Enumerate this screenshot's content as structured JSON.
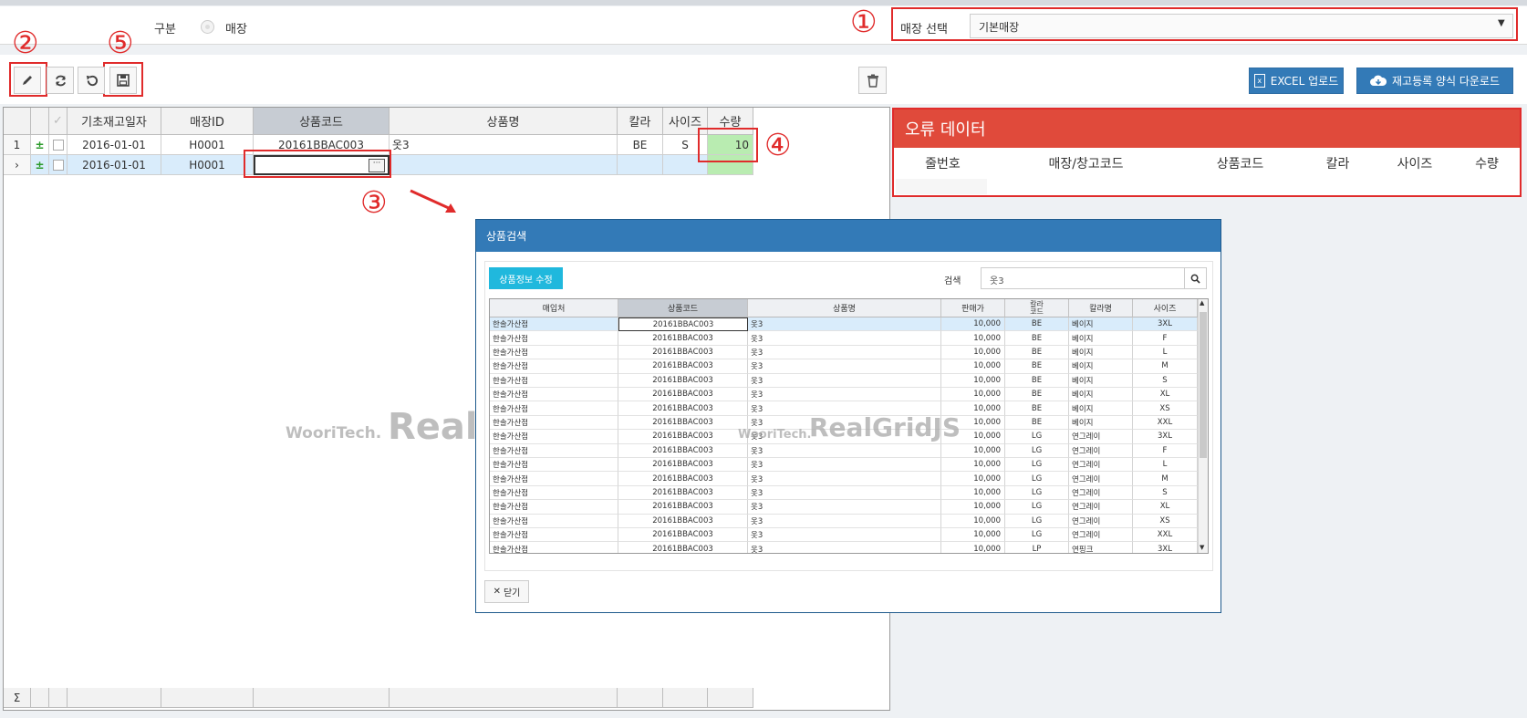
{
  "filter": {
    "label": "구분",
    "radio_label": "매장",
    "store_select_label": "매장 선택",
    "store_select_value": "기본매장"
  },
  "annotations": {
    "n1": "①",
    "n2": "②",
    "n3": "③",
    "n4": "④",
    "n5": "⑤"
  },
  "toolbar": {
    "icons": [
      "pencil-icon",
      "refresh-icon",
      "undo-icon",
      "save-icon",
      "trash-icon"
    ],
    "excel_upload": "EXCEL 업로드",
    "template_download": "재고등록 양식 다운로드"
  },
  "grid": {
    "columns": [
      "기초재고일자",
      "매장ID",
      "상품코드",
      "상품명",
      "칼라",
      "사이즈",
      "수량"
    ],
    "rows": [
      {
        "num": "1",
        "date": "2016-01-01",
        "store": "H0001",
        "code": "20161BBAC003",
        "name": "옷3",
        "color": "BE",
        "size": "S",
        "qty": "10"
      },
      {
        "num": "",
        "date": "2016-01-01",
        "store": "H0001",
        "code": "",
        "name": "",
        "color": "",
        "size": "",
        "qty": ""
      }
    ],
    "footer_symbol": "Σ"
  },
  "error_panel": {
    "title": "오류 데이터",
    "columns": [
      "줄번호",
      "매장/창고코드",
      "상품코드",
      "칼라",
      "사이즈",
      "수량"
    ]
  },
  "dialog": {
    "title": "상품검색",
    "edit_button": "상품정보 수정",
    "search_label": "검색",
    "search_value": "옷3",
    "close_button": "닫기",
    "columns": [
      "매입처",
      "상품코드",
      "상품명",
      "판매가",
      "칼라\n코드",
      "칼라명",
      "사이즈"
    ],
    "rows": [
      [
        "한솔가산점",
        "20161BBAC003",
        "옷3",
        "10,000",
        "BE",
        "베이지",
        "3XL"
      ],
      [
        "한솔가산점",
        "20161BBAC003",
        "옷3",
        "10,000",
        "BE",
        "베이지",
        "F"
      ],
      [
        "한솔가산점",
        "20161BBAC003",
        "옷3",
        "10,000",
        "BE",
        "베이지",
        "L"
      ],
      [
        "한솔가산점",
        "20161BBAC003",
        "옷3",
        "10,000",
        "BE",
        "베이지",
        "M"
      ],
      [
        "한솔가산점",
        "20161BBAC003",
        "옷3",
        "10,000",
        "BE",
        "베이지",
        "S"
      ],
      [
        "한솔가산점",
        "20161BBAC003",
        "옷3",
        "10,000",
        "BE",
        "베이지",
        "XL"
      ],
      [
        "한솔가산점",
        "20161BBAC003",
        "옷3",
        "10,000",
        "BE",
        "베이지",
        "XS"
      ],
      [
        "한솔가산점",
        "20161BBAC003",
        "옷3",
        "10,000",
        "BE",
        "베이지",
        "XXL"
      ],
      [
        "한솔가산점",
        "20161BBAC003",
        "옷3",
        "10,000",
        "LG",
        "연그레이",
        "3XL"
      ],
      [
        "한솔가산점",
        "20161BBAC003",
        "옷3",
        "10,000",
        "LG",
        "연그레이",
        "F"
      ],
      [
        "한솔가산점",
        "20161BBAC003",
        "옷3",
        "10,000",
        "LG",
        "연그레이",
        "L"
      ],
      [
        "한솔가산점",
        "20161BBAC003",
        "옷3",
        "10,000",
        "LG",
        "연그레이",
        "M"
      ],
      [
        "한솔가산점",
        "20161BBAC003",
        "옷3",
        "10,000",
        "LG",
        "연그레이",
        "S"
      ],
      [
        "한솔가산점",
        "20161BBAC003",
        "옷3",
        "10,000",
        "LG",
        "연그레이",
        "XL"
      ],
      [
        "한솔가산점",
        "20161BBAC003",
        "옷3",
        "10,000",
        "LG",
        "연그레이",
        "XS"
      ],
      [
        "한솔가산점",
        "20161BBAC003",
        "옷3",
        "10,000",
        "LG",
        "연그레이",
        "XXL"
      ],
      [
        "한솔가산점",
        "20161BBAC003",
        "옷3",
        "10,000",
        "LP",
        "연핑크",
        "3XL"
      ]
    ]
  },
  "watermark": {
    "brand": "WooriTech.",
    "product": "RealGridJS",
    "product_clip": "Real"
  },
  "colors": {
    "annotation_red": "#e02b2b",
    "header_blue": "#337ab7",
    "error_red": "#e04a3b",
    "qty_green": "#b9ecb1",
    "selected_row": "#d9ecfb",
    "teal_button": "#20b8dd"
  }
}
